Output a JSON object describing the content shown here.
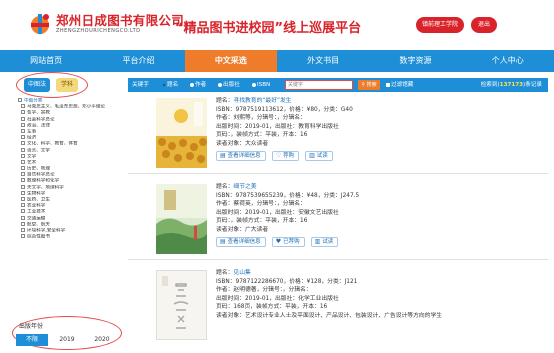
{
  "header": {
    "company_name": "郑州日成图书有限公司",
    "company_en": "ZHENGZHOURICHENGCO.LTD",
    "slogan": "“精品图书进校园”线上巡展平台",
    "school_button": "镇前理工学院",
    "logout_button": "退出",
    "brand_color": "#d9232a"
  },
  "nav": {
    "items": [
      "网站首页",
      "平台介绍",
      "中文采选",
      "外文书目",
      "数字资源",
      "个人中心"
    ],
    "active_index": 2,
    "nav_color": "#1e8fd6",
    "active_color": "#ee7c2b"
  },
  "sidebar": {
    "tab_category": "中图法",
    "tab_subject": "学科",
    "tree": [
      "中图分类",
      "马克思主义、毛泽东思想、邓小平理论",
      "哲学、宗教",
      "社会科学总论",
      "政治、法律",
      "军事",
      "经济",
      "文化、科学、教育、体育",
      "语言、文字",
      "文学",
      "艺术",
      "历史、地理",
      "自然科学总论",
      "数理科学和化学",
      "天文学、地球科学",
      "生物科学",
      "医药、卫生",
      "农业科学",
      "工业技术",
      "交通运输",
      "航空、航天",
      "环境科学,安全科学",
      "综合性图书"
    ],
    "year_title": "出版年份",
    "years": [
      "不限",
      "2019",
      "2020"
    ],
    "active_year_index": 0
  },
  "search": {
    "label": "关键字",
    "options": [
      "题名",
      "作者",
      "出版社",
      "ISBN"
    ],
    "selected_option_index": 0,
    "placeholder": "关键字",
    "button_label": "搜索",
    "filter_label": "过滤馆藏",
    "count_prefix": "检索到(",
    "count_value": "137173",
    "count_suffix": ")条记录"
  },
  "results": [
    {
      "title_label": "题名：",
      "title": "寻找教育的“最好”发生",
      "isbn_line": "ISBN：9787519113612，价格：¥80，分类：G40",
      "author_line": "作者：刘熙等，分辑号：，分辑名：",
      "pub_line": "出版时间：2019-01，出版社：教育科学出版社",
      "pages_line": "页码：，装帧方式：平装，开本：16",
      "reader_line": "读者对象：大众读者",
      "cover_title": "寻找教育的“最好”发生",
      "btn_recommend": "查看详细信息",
      "btn_pref": "荐购",
      "btn_trial": "试读"
    },
    {
      "title_label": "题名：",
      "title": "细节之美",
      "isbn_line": "ISBN：9787539655239，价格：¥48，分类：J247.5",
      "author_line": "作者：蔡荷英，分辑号：，分辑名：",
      "pub_line": "出版时间：2019-01，出版社：安徽文艺出版社",
      "pages_line": "页码：，装帧方式：平装，开本：16",
      "reader_line": "读者对象：广大读者",
      "cover_title": "细节之美",
      "btn_recommend": "查看详细信息",
      "btn_pref": "已荐购",
      "btn_trial": "试读"
    },
    {
      "title_label": "题名：",
      "title": "见山集",
      "isbn_line": "ISBN：9787122286670，价格：¥128，分类：J121",
      "author_line": "作者：赵明德著，分辑号：，分辑名：",
      "pub_line": "出版时间：2019-01，出版社：化学工业出版社",
      "pages_line": "页码：168页，装帧方式：平装，开本：16",
      "reader_line": "读者对象：艺术设计专业人士及平面设计、产品设计、包装设计、广告设计等方向的学生",
      "cover_title": "见山集",
      "btn_recommend": "查看详细信息",
      "btn_pref": "荐购",
      "btn_trial": "试读"
    }
  ]
}
